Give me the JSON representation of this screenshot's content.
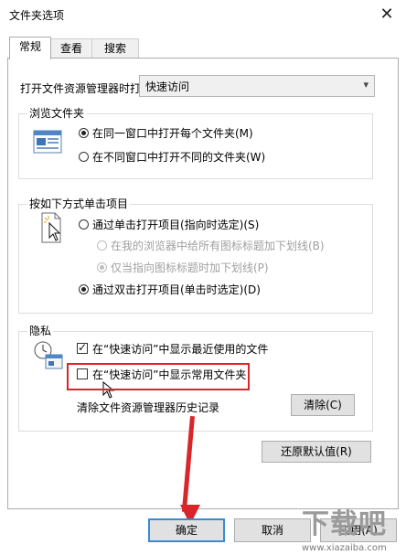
{
  "window": {
    "title": "文件夹选项"
  },
  "tabs": [
    {
      "label": "常规"
    },
    {
      "label": "查看"
    },
    {
      "label": "搜索"
    }
  ],
  "open_explorer": {
    "label": "打开文件资源管理器时打",
    "value": "快速访问"
  },
  "browse": {
    "group_label": "浏览文件夹",
    "same_window": "在同一窗口中打开每个文件夹(M)",
    "new_window": "在不同窗口中打开不同的文件夹(W)"
  },
  "click": {
    "group_label": "按如下方式单击项目",
    "single_click": "通过单击打开项目(指向时选定)(S)",
    "underline_all": "在我的浏览器中给所有图标标题加下划线(B)",
    "underline_point": "仅当指向图标标题时加下划线(P)",
    "double_click": "通过双击打开项目(单击时选定)(D)"
  },
  "privacy": {
    "group_label": "隐私",
    "recent_files": "在“快速访问”中显示最近使用的文件",
    "frequent_folders": "在“快速访问”中显示常用文件夹",
    "clear_history_label": "清除文件资源管理器历史记录",
    "clear_button": "清除(C)"
  },
  "restore_defaults": "还原默认值(R)",
  "footer": {
    "ok": "确定",
    "cancel": "取消",
    "apply": "应用(A)"
  },
  "colors": {
    "highlight": "#d9262a",
    "focus": "#3a8bd6"
  }
}
